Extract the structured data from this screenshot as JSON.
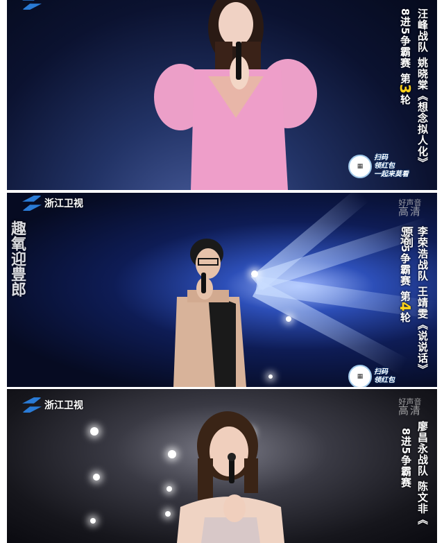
{
  "panels": [
    {
      "team": "汪峰战队",
      "singer": "姚晓棠",
      "song": "《想念拟人化》",
      "stage_pre": "8进5争霸赛 第",
      "round_num": "3",
      "stage_post": "轮",
      "badge_line1": "扫码",
      "badge_line2": "领红包",
      "badge_line3": "一起来莫看"
    },
    {
      "channel": "浙江卫视",
      "hd_top": "好声音",
      "hd_main": "高清",
      "team": "李荣浩战队",
      "singer": "王靖雯",
      "song": "《说说话》原创",
      "stage_pre": "8进5争霸赛 第",
      "round_num": "4",
      "stage_post": "轮",
      "badge_line1": "扫码",
      "badge_line2": "领红包",
      "side_caption": "趣氧迎豊郎"
    },
    {
      "channel": "浙江卫视",
      "hd_top": "好声音",
      "hd_main": "高清",
      "team": "廖昌永战队",
      "singer": "陈文非",
      "song": "《",
      "stage_pre": "8进5争霸赛",
      "round_num": "",
      "stage_post": ""
    }
  ],
  "colors": {
    "round_highlight": "#ffd21a",
    "logo_blue": "#2a7bd6"
  },
  "icons": [
    "zhejiang-tv-logo-icon",
    "qr-code-icon"
  ]
}
